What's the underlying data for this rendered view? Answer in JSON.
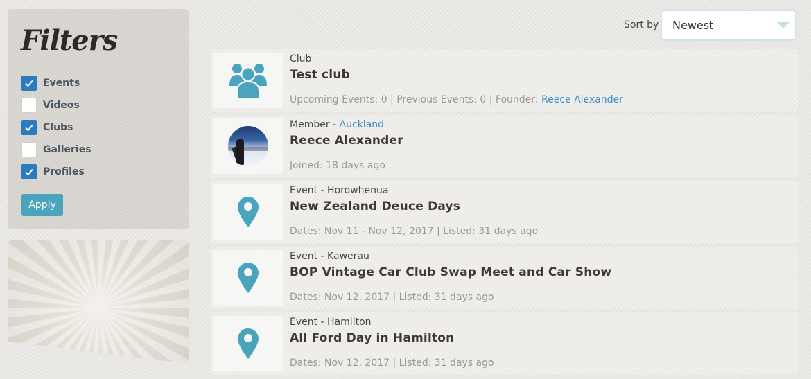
{
  "filters": {
    "title": "Filters",
    "items": [
      {
        "label": "Events",
        "checked": true
      },
      {
        "label": "Videos",
        "checked": false
      },
      {
        "label": "Clubs",
        "checked": true
      },
      {
        "label": "Galleries",
        "checked": false
      },
      {
        "label": "Profiles",
        "checked": true
      }
    ],
    "apply_label": "Apply"
  },
  "sort": {
    "label": "Sort by",
    "value": "Newest"
  },
  "results": [
    {
      "type": "Club",
      "location": "",
      "title": "Test club",
      "details": "Upcoming Events: 0 | Previous Events: 0 | Founder: ",
      "details_link": "Reece Alexander",
      "icon": "group-icon"
    },
    {
      "type": "Member - ",
      "location": "Auckland",
      "title": "Reece Alexander",
      "details": "Joined: 18 days ago",
      "icon": "avatar"
    },
    {
      "type": "Event - Horowhenua",
      "title": "New Zealand Deuce Days",
      "details": "Dates: Nov 11 - Nov 12, 2017 | Listed: 31 days ago",
      "icon": "map-pin-icon"
    },
    {
      "type": "Event - Kawerau",
      "title": "BOP Vintage Car Club Swap Meet and Car Show",
      "details": "Dates: Nov 12, 2017 | Listed: 31 days ago",
      "icon": "map-pin-icon"
    },
    {
      "type": "Event - Hamilton",
      "title": "All Ford Day in Hamilton",
      "details": "Dates: Nov 12, 2017 | Listed: 31 days ago",
      "icon": "map-pin-icon"
    }
  ],
  "colors": {
    "accent": "#4aa4be",
    "checkbox": "#2b7bc1",
    "link": "#3b8fc4"
  }
}
